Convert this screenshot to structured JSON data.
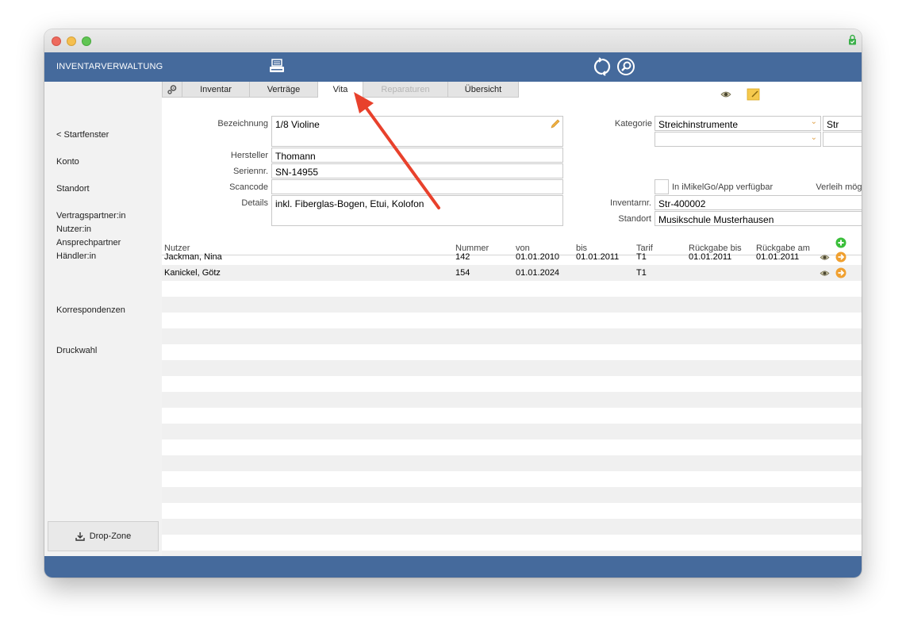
{
  "app": {
    "title": "INVENTARVERWALTUNG"
  },
  "sidebar": {
    "items": [
      "< Startfenster",
      "Konto",
      "Standort",
      "Vertragspartner:in",
      "Nutzer:in",
      "Ansprechpartner",
      "Händler:in",
      "Korrespondenzen",
      "Druckwahl"
    ],
    "dropzone_label": "Drop-Zone"
  },
  "tabs": [
    {
      "label": "Inventar"
    },
    {
      "label": "Verträge"
    },
    {
      "label": "Vita"
    },
    {
      "label": "Reparaturen"
    },
    {
      "label": "Übersicht"
    }
  ],
  "form": {
    "bezeichnung_label": "Bezeichnung",
    "bezeichnung_value": "1/8 Violine",
    "hersteller_label": "Hersteller",
    "hersteller_value": "Thomann",
    "seriennr_label": "Seriennr.",
    "seriennr_value": "SN-14955",
    "scancode_label": "Scancode",
    "scancode_value": "",
    "details_label": "Details",
    "details_value": "inkl. Fiberglas-Bogen, Etui, Kolofon",
    "kategorie_label": "Kategorie",
    "kategorie_value": "Streichinstrumente",
    "kategorie_code": "Str",
    "kategorie2_value": "",
    "kategorie2_code": "",
    "app_label": "In iMikelGo/App verfügbar",
    "verleih_label": "Verleih möglich",
    "verleih_check": "√",
    "inventarnr_label": "Inventarnr.",
    "inventarnr_value": "Str-400002",
    "standort_label": "Standort",
    "standort_value": "Musikschule Musterhausen"
  },
  "table": {
    "headers": [
      "Nutzer",
      "Nummer",
      "von",
      "bis",
      "Tarif",
      "Rückgabe bis",
      "Rückgabe am"
    ],
    "rows": [
      {
        "nutzer": "Jackman, Nina",
        "nummer": "142",
        "von": "01.01.2010",
        "bis": "01.01.2011",
        "tarif": "T1",
        "rueckgabe_bis": "01.01.2011",
        "rueckgabe_am": "01.01.2011"
      },
      {
        "nutzer": "Kanickel, Götz",
        "nummer": "154",
        "von": "01.01.2024",
        "bis": "",
        "tarif": "T1",
        "rueckgabe_bis": "",
        "rueckgabe_am": ""
      }
    ]
  },
  "colors": {
    "accent": "#456a9c",
    "annotation_arrow": "#e8412c",
    "checkbox_yellow": "#ffff00"
  }
}
